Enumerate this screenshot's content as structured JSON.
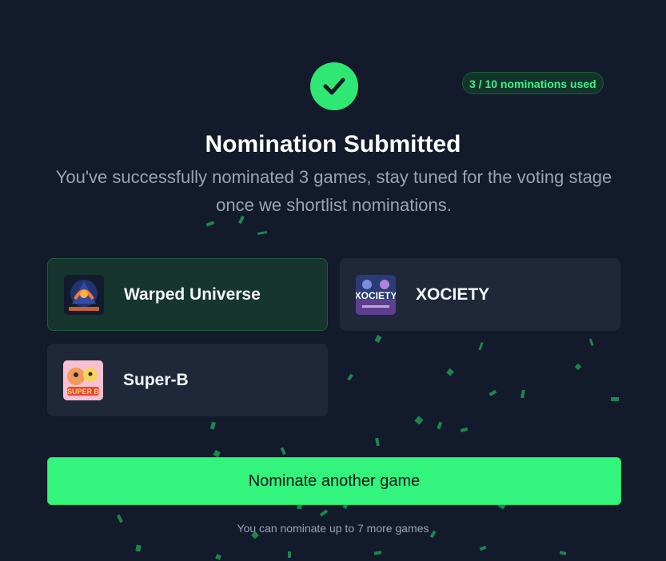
{
  "header": {
    "usage_badge": "3 / 10 nominations used",
    "title": "Nomination Submitted",
    "subtitle": "You've successfully nominated 3 games, stay tuned for the voting stage once we shortlist nominations."
  },
  "status_icon": "check-icon",
  "colors": {
    "background": "#121a2b",
    "accent": "#33f47c",
    "card": "#1f2839",
    "card_selected": "#16352e"
  },
  "nominations": [
    {
      "name": "Warped Universe",
      "selected": true,
      "thumb_icon": "warped-universe-thumbnail"
    },
    {
      "name": "XOCIETY",
      "selected": false,
      "thumb_icon": "xociety-thumbnail"
    },
    {
      "name": "Super-B",
      "selected": false,
      "thumb_icon": "super-b-thumbnail"
    }
  ],
  "actions": {
    "nominate_another": "Nominate another game"
  },
  "footer": {
    "remaining_text": "You can nominate up to 7 more games"
  }
}
